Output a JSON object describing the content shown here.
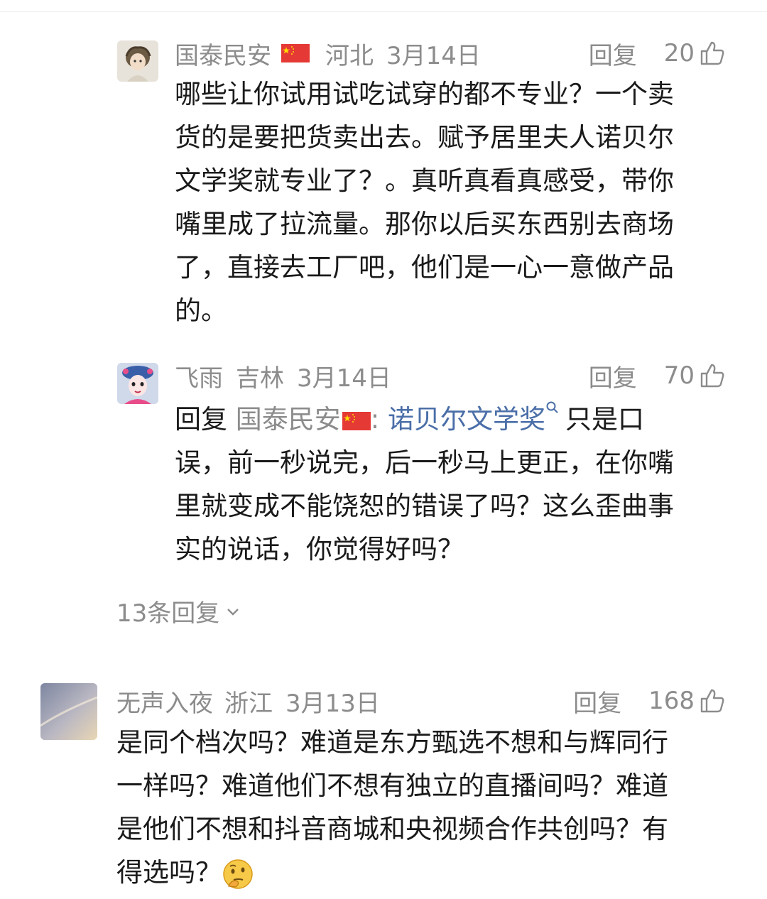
{
  "thread": [
    {
      "username": "国泰民安",
      "location": "河北",
      "date": "3月14日",
      "reply_label": "回复",
      "likes": "20",
      "lines": [
        "哪些让你试用试吃试穿的都不专业？一个卖",
        "货的是要把货卖出去。赋予居里夫人诺贝尔",
        "文学奖就专业了？。真听真看真感受，带你",
        "嘴里成了拉流量。那你以后买东西别去商场",
        "了，直接去工厂吧，他们是一心一意做产品",
        "的。"
      ]
    },
    {
      "username": "飞雨",
      "location": "吉林",
      "date": "3月14日",
      "reply_label": "回复",
      "likes": "70",
      "reply_prefix": "回复",
      "reply_to": "国泰民安",
      "colon": ":",
      "keyword": "诺贝尔文学奖",
      "first_line_rest": "只是口",
      "lines": [
        "误，前一秒说完，后一秒马上更正，在你嘴",
        "里就变成不能饶恕的错误了吗？这么歪曲事",
        "实的说话，你觉得好吗？"
      ]
    }
  ],
  "more_replies": "13条回复",
  "second_comment": {
    "username": "无声入夜",
    "location": "浙江",
    "date": "3月13日",
    "reply_label": "回复",
    "likes": "168",
    "lines": [
      "是同个档次吗？难道是东方甄选不想和与辉同行",
      "一样吗？难道他们不想有独立的直播间吗？难道",
      "是他们不想和抖音商城和央视频合作共创吗？有"
    ],
    "last_line": "得选吗？"
  },
  "colors": {
    "meta_gray": "#8c8c8c",
    "keyword_blue": "#4a6ea8",
    "text": "#1a1a1a"
  }
}
